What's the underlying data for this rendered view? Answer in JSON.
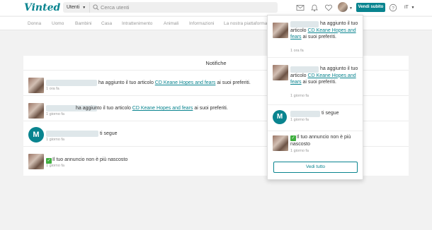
{
  "header": {
    "logo": "Vinted",
    "category_select": "Utenti",
    "search_placeholder": "Cerca utenti",
    "sell_button": "Vendi subito",
    "language": "IT"
  },
  "categories": [
    "Donna",
    "Uomo",
    "Bambini",
    "Casa",
    "Intrattenimento",
    "Animali",
    "Informazioni",
    "La nostra piattaforma"
  ],
  "notifications_page": {
    "title": "Notifiche",
    "rows": [
      {
        "text_before": "ha aggiunto il tuo articolo ",
        "link": "CD Keane Hopes and fears",
        "text_after": " ai suoi preferiti.",
        "time": "1 ora fa"
      },
      {
        "text_before": "ha aggiunto il tuo articolo ",
        "link": "CD Keane Hopes and fears",
        "text_after": " ai suoi preferiti.",
        "time": "1 giorno fa"
      },
      {
        "text": "ti segue",
        "time": "1 giorno fa",
        "avatar_letter": "M"
      },
      {
        "text": "Il tuo annuncio non è più nascosto",
        "time": "1 giorno fa"
      }
    ]
  },
  "dropdown": {
    "items": [
      {
        "text_before": "ha aggiunto il tuo articolo ",
        "link": "CD Keane Hopes and fears",
        "text_after": " ai suoi preferiti.",
        "time": "1 ora fa"
      },
      {
        "text_before": "ha aggiunto il tuo articolo ",
        "link": "CD Keane Hopes and fears",
        "text_after": " ai suoi preferiti.",
        "time": "1 giorno fa"
      },
      {
        "text": "ti segue",
        "time": "1 giorno fa",
        "avatar_letter": "M"
      },
      {
        "text": "Il tuo annuncio non è più nascosto",
        "time": "1 giorno fa"
      }
    ],
    "see_all": "Vedi tutto"
  },
  "colors": {
    "brand": "#09848f",
    "check": "#3fae3f"
  },
  "icons": [
    "chevron-down-icon",
    "search-icon",
    "mail-icon",
    "bell-icon",
    "heart-icon",
    "help-icon",
    "checkmark-icon"
  ]
}
